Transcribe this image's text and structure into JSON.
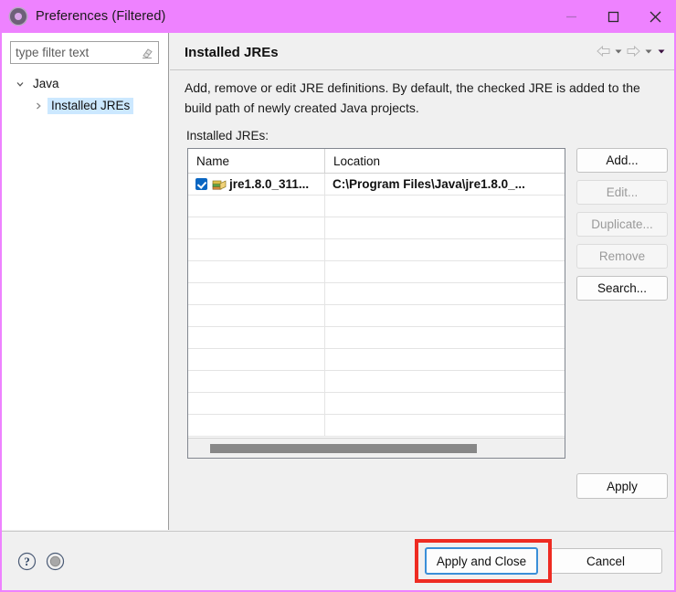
{
  "window": {
    "title": "Preferences (Filtered)",
    "icon": "gear-icon",
    "controls": {
      "minimize": "minimize-icon",
      "maximize": "maximize-icon",
      "close": "close-icon"
    },
    "titlebar_color": "#EE82FF"
  },
  "filter": {
    "placeholder": "type filter text",
    "value": "",
    "clear_icon": "eraser-icon"
  },
  "tree": {
    "items": [
      {
        "label": "Java",
        "level": 1,
        "expanded": true,
        "selected": false,
        "twisty": "chevron-down-icon"
      },
      {
        "label": "Installed JREs",
        "level": 2,
        "expanded": false,
        "selected": true,
        "twisty": "chevron-right-icon"
      }
    ]
  },
  "page": {
    "title": "Installed JREs",
    "description": "Add, remove or edit JRE definitions. By default, the checked JRE is added to the build path of newly created Java projects.",
    "list_label": "Installed JREs:"
  },
  "nav": {
    "back": "back-arrow-icon",
    "back_menu": "chevron-down-icon",
    "forward": "forward-arrow-icon",
    "forward_menu": "chevron-down-icon",
    "view_menu": "chevron-down-icon"
  },
  "table": {
    "columns": [
      "Name",
      "Location"
    ],
    "rows": [
      {
        "checked": true,
        "icon": "jre-library-icon",
        "name": "jre1.8.0_311...",
        "location": "C:\\Program Files\\Java\\jre1.8.0_..."
      }
    ],
    "empty_row_count": 10,
    "hscroll": {
      "visible": true
    }
  },
  "side_buttons": [
    {
      "label": "Add...",
      "enabled": true
    },
    {
      "label": "Edit...",
      "enabled": false
    },
    {
      "label": "Duplicate...",
      "enabled": false
    },
    {
      "label": "Remove",
      "enabled": false
    },
    {
      "label": "Search...",
      "enabled": true
    }
  ],
  "apply_button": {
    "label": "Apply",
    "enabled": true
  },
  "bottom": {
    "help_icon": "help-icon",
    "record_icon": "record-icon",
    "apply_and_close": {
      "label": "Apply and Close",
      "focused": true
    },
    "cancel": {
      "label": "Cancel"
    }
  },
  "annotation": {
    "color": "#EE2B22",
    "target": "apply-and-close-button"
  }
}
